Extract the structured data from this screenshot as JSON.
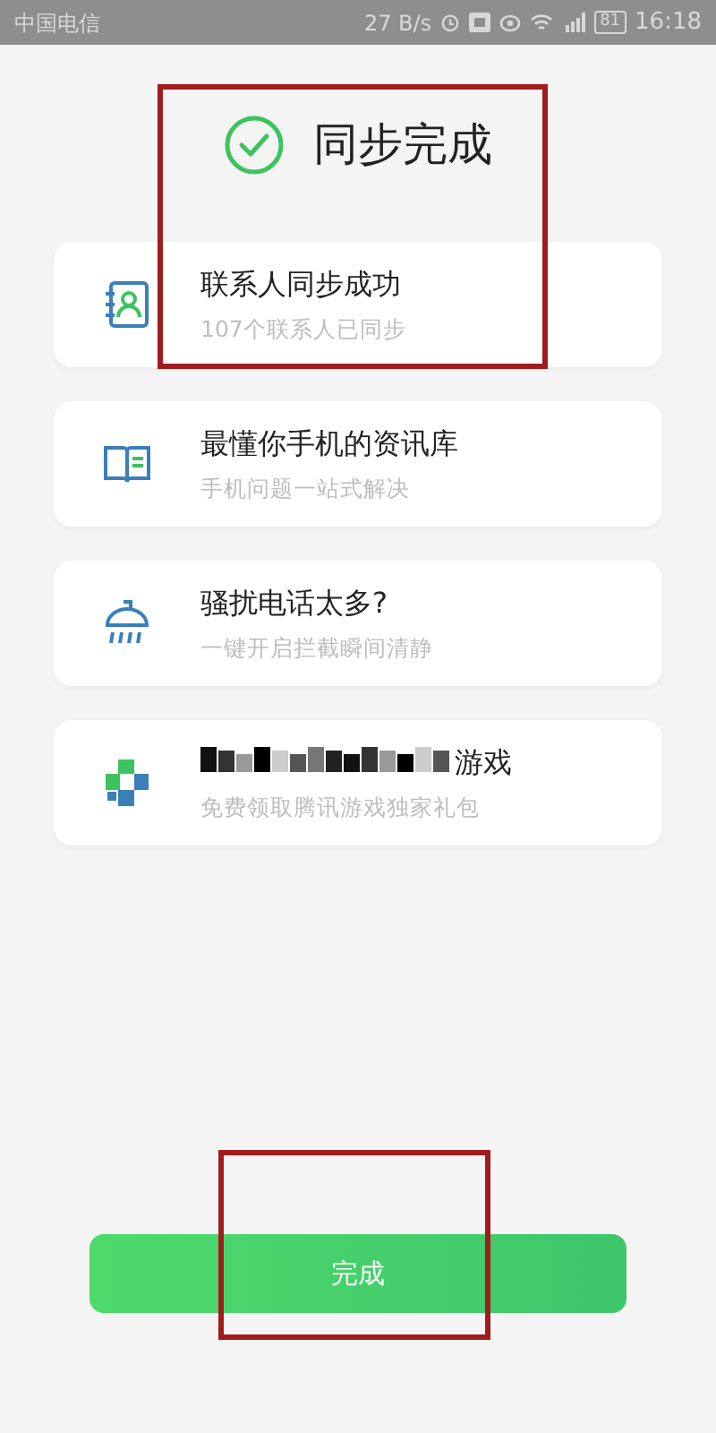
{
  "status_bar": {
    "carrier": "中国电信",
    "speed": "27 B/s",
    "battery": "81",
    "time": "16:18"
  },
  "header": {
    "title": "同步完成",
    "highlighted": true
  },
  "cards": [
    {
      "kind": "contacts",
      "title": "联系人同步成功",
      "subtitle": "107个联系人已同步",
      "obscured": false
    },
    {
      "kind": "book",
      "title": "最懂你手机的资讯库",
      "subtitle": "手机问题一站式解决",
      "obscured": false
    },
    {
      "kind": "shower",
      "title": "骚扰电话太多?",
      "subtitle": "一键开启拦截瞬间清静",
      "obscured": false
    },
    {
      "kind": "cross",
      "title": "游戏",
      "subtitle": "免费领取腾讯游戏独家礼包",
      "obscured": true
    }
  ],
  "button": {
    "label": "完成",
    "highlighted": true
  }
}
